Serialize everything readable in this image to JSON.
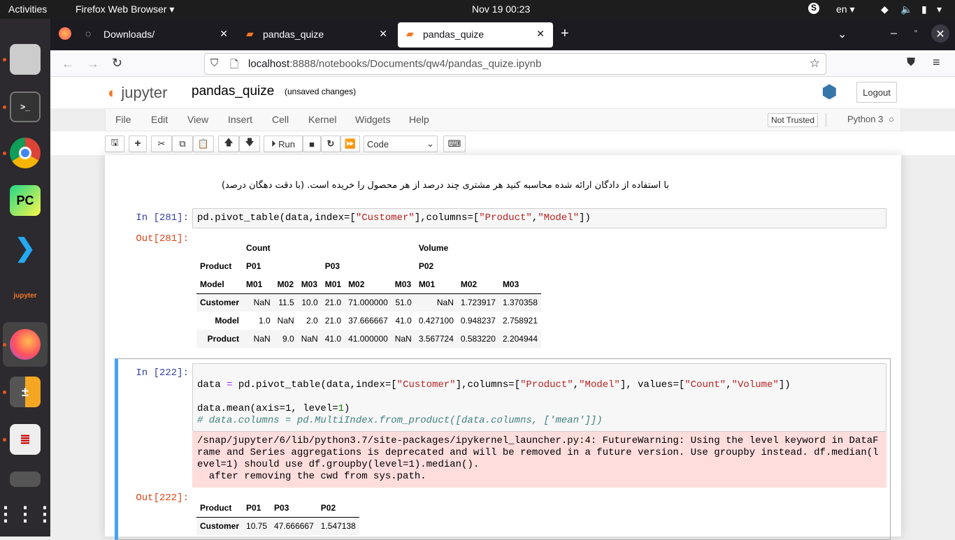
{
  "topbar": {
    "activities": "Activities",
    "app": "Firefox Web Browser ▾",
    "clock": "Nov 19  00:23",
    "lang": "en ▾"
  },
  "tabs": [
    {
      "label": "Downloads/"
    },
    {
      "label": "pandas_quize"
    },
    {
      "label": "pandas_quize"
    }
  ],
  "url": {
    "host": "localhost",
    "rest": ":8888/notebooks/Documents/qw4/pandas_quize.ipynb"
  },
  "jupyter": {
    "logo": "jupyter",
    "title": "pandas_quize",
    "status": "(unsaved changes)",
    "logout": "Logout",
    "menu": [
      "File",
      "Edit",
      "View",
      "Insert",
      "Cell",
      "Kernel",
      "Widgets",
      "Help"
    ],
    "trust": "Not Trusted",
    "kernel": "Python 3",
    "run": "Run",
    "cell_type": "Code"
  },
  "markdown_text": "با استفاده از دادگان ارائه شده محاسبه کنید هر مشتری چند درصد از هر محصول را خریده است. (با دقت دهگان درصد)",
  "cell1": {
    "in": "In [281]:",
    "out": "Out[281]:",
    "code": "pd.pivot_table(data,index=[\"Customer\"],columns=[\"Product\",\"Model\"])",
    "head1": [
      "",
      "Count",
      "",
      "",
      "",
      "",
      "",
      "Volume",
      "",
      ""
    ],
    "head2": [
      "Product",
      "P01",
      "",
      "",
      "P03",
      "",
      "",
      "P02",
      "",
      ""
    ],
    "head3": [
      "Model",
      "M01",
      "M02",
      "M03",
      "M01",
      "M02",
      "M03",
      "M01",
      "M02",
      "M03"
    ],
    "rows": [
      [
        "Customer",
        "NaN",
        "11.5",
        "10.0",
        "21.0",
        "71.000000",
        "51.0",
        "NaN",
        "1.723917",
        "1.370358"
      ],
      [
        "Model",
        "1.0",
        "NaN",
        "2.0",
        "21.0",
        "37.666667",
        "41.0",
        "0.427100",
        "0.948237",
        "2.758921"
      ],
      [
        "Product",
        "NaN",
        "9.0",
        "NaN",
        "41.0",
        "41.000000",
        "NaN",
        "3.567724",
        "0.583220",
        "2.204944"
      ]
    ]
  },
  "cell2": {
    "in": "In [222]:",
    "out": "Out[222]:",
    "line1": "data = pd.pivot_table(data,index=[\"Customer\"],columns=[\"Product\",\"Model\"], values=[\"Count\",\"Volume\"])",
    "line2": "data.mean(axis=1, level=1)",
    "line3": "# data.columns = pd.MultiIndex.from_product([data.columns, ['mean']])",
    "warning": "/snap/jupyter/6/lib/python3.7/site-packages/ipykernel_launcher.py:4: FutureWarning: Using the level keyword in DataF\nrame and Series aggregations is deprecated and will be removed in a future version. Use groupby instead. df.median(l\nevel=1) should use df.groupby(level=1).median().\n  after removing the cwd from sys.path.",
    "head": [
      "Product",
      "P01",
      "P03",
      "P02"
    ],
    "row": [
      "Customer",
      "10.75",
      "47.666667",
      "1.547138"
    ]
  }
}
